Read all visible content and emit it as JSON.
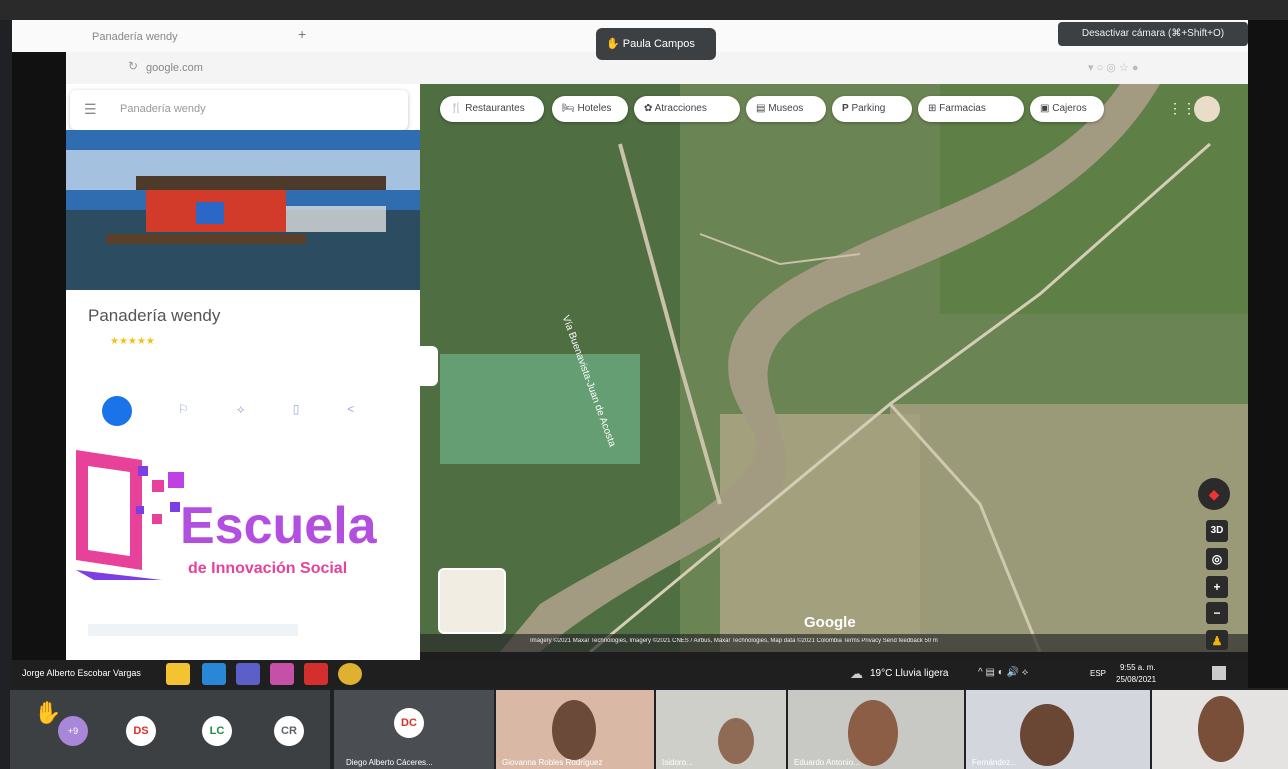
{
  "presenter_banner": {
    "label": "Paula Campos"
  },
  "tooltip": {
    "label": "Desactivar cámara (⌘+Shift+O)"
  },
  "browser": {
    "tab_label": "Panadería wendy",
    "address": "google.com"
  },
  "maps": {
    "search_placeholder": "Panadería wendy",
    "place_name": "Panadería wendy",
    "rating_stars": "★★★★★",
    "chips": [
      "Restaurantes",
      "Hoteles",
      "Atracciones",
      "Museos",
      "Parking",
      "Farmacias",
      "Cajeros"
    ],
    "road_label": "Vía Buenavista-Juan de Acosta",
    "google_logo": "Google",
    "controls": {
      "view_3d": "3D",
      "zoom_in": "+",
      "zoom_out": "−"
    },
    "attribution": "Imagery ©2021 Maxar Technologies, Imagery ©2021 CNES / Airbus, Maxar Technologies, Map data ©2021   Colombia   Terms   Privacy   Send feedback   50 m"
  },
  "overlay_logo": {
    "title": "Escuela",
    "subtitle": "de Innovación Social",
    "colors": {
      "pink": "#e8419a",
      "purple": "#7b3fe4"
    }
  },
  "taskbar": {
    "weather": "19°C  Lluvia ligera",
    "lang": "ESP",
    "time": "9:55 a. m.",
    "date": "25/08/2021"
  },
  "participants": {
    "self_label": "Jorge Alberto Escobar Vargas",
    "small_avatars": [
      {
        "initials": "DS",
        "color": "#d93025"
      },
      {
        "initials": "LC",
        "color": "#1e8e3e"
      },
      {
        "initials": "CR",
        "color": "#5f6368"
      }
    ],
    "dc_tile": {
      "initials": "DC",
      "name": "Diego Alberto Cáceres..."
    },
    "video_tiles": [
      {
        "name": "Giovanna Robles Rodríguez"
      },
      {
        "name": "Isidoro..."
      },
      {
        "name": "Eduardo Antonio..."
      },
      {
        "name": "Fernández..."
      },
      {
        "name": ""
      }
    ]
  }
}
